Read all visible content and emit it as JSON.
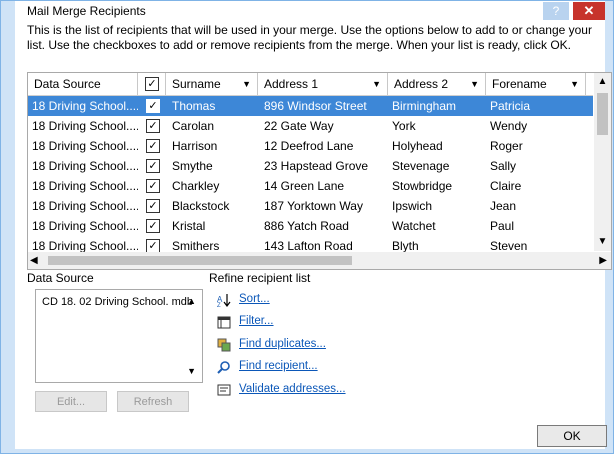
{
  "window": {
    "title": "Mail Merge Recipients",
    "help": "?",
    "close": "✕"
  },
  "description": "This is the list of recipients that will be used in your merge. Use the options below to add to or change your list. Use the checkboxes to add or remove recipients from the merge. When your list is ready, click OK.",
  "columns": {
    "data_source": "Data Source",
    "surname": "Surname",
    "address1": "Address 1",
    "address2": "Address 2",
    "forename": "Forename"
  },
  "rows": [
    {
      "source": "18 Driving School....",
      "checked": "✓",
      "surname": "Thomas",
      "address1": "896 Windsor Street",
      "address2": "Birmingham",
      "forename": "Patricia"
    },
    {
      "source": "18 Driving School....",
      "checked": "✓",
      "surname": "Carolan",
      "address1": "22 Gate Way",
      "address2": "York",
      "forename": "Wendy"
    },
    {
      "source": "18 Driving School....",
      "checked": "✓",
      "surname": "Harrison",
      "address1": "12 Deefrod Lane",
      "address2": "Holyhead",
      "forename": "Roger"
    },
    {
      "source": "18 Driving School....",
      "checked": "✓",
      "surname": "Smythe",
      "address1": "23 Hapstead Grove",
      "address2": "Stevenage",
      "forename": "Sally"
    },
    {
      "source": "18 Driving School....",
      "checked": "✓",
      "surname": "Charkley",
      "address1": "14 Green Lane",
      "address2": "Stowbridge",
      "forename": "Claire"
    },
    {
      "source": "18 Driving School....",
      "checked": "✓",
      "surname": "Blackstock",
      "address1": "187 Yorktown Way",
      "address2": "Ipswich",
      "forename": "Jean"
    },
    {
      "source": "18 Driving School....",
      "checked": "✓",
      "surname": "Kristal",
      "address1": "886 Yatch Road",
      "address2": "Watchet",
      "forename": "Paul"
    },
    {
      "source": "18 Driving School....",
      "checked": "✓",
      "surname": "Smithers",
      "address1": "143 Lafton Road",
      "address2": "Blyth",
      "forename": "Steven"
    }
  ],
  "header_checkbox": "✓",
  "scroll": {
    "up": "▲",
    "down": "▼",
    "left": "◀",
    "right": "▶"
  },
  "data_source_panel": {
    "label": "Data Source",
    "item": "CD 18. 02 Driving School. mdb",
    "edit": "Edit...",
    "refresh": "Refresh"
  },
  "refine": {
    "label": "Refine recipient list",
    "sort": "Sort...",
    "filter": "Filter...",
    "find_duplicates": "Find duplicates...",
    "find_recipient": "Find recipient...",
    "validate": "Validate addresses..."
  },
  "ok": "OK",
  "colors": {
    "selection": "#3d87d7",
    "link": "#0b57b8",
    "close": "#c7332c"
  }
}
